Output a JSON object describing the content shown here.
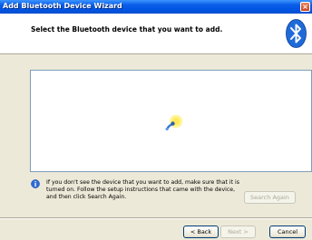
{
  "window": {
    "title": "Add Bluetooth Device Wizard",
    "close_glyph": "×"
  },
  "header": {
    "heading": "Select the Bluetooth device that you want to add.",
    "logo_icon": "bluetooth-icon"
  },
  "device_list": {
    "status_icon": "searching-animation-icon"
  },
  "info": {
    "icon": "info-icon",
    "message": "If you don't see the device that you want to add, make sure that it is turned on. Follow the setup instructions that came with the device, and then click Search Again."
  },
  "buttons": {
    "search_again": "Search Again",
    "back": "< Back",
    "next": "Next >",
    "cancel": "Cancel"
  },
  "colors": {
    "titlebar": "#0054e3",
    "dialog_bg": "#ece9d8",
    "bluetooth_blue": "#1f6ad8"
  }
}
